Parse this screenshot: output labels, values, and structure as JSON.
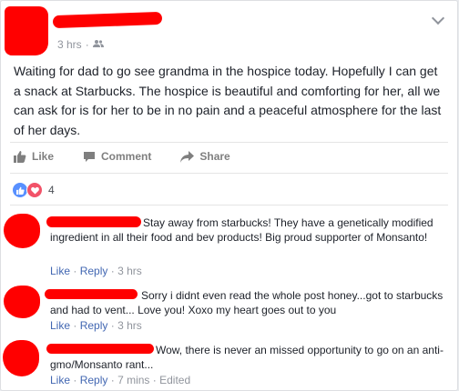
{
  "post": {
    "timestamp": "3 hrs",
    "audience_icon": "friends-icon",
    "text": "Waiting for dad to go see grandma in the hospice today. Hopefully I can get a snack at Starbucks. The hospice is beautiful and comforting for her, all we can ask for is for her to be in no pain and a peaceful atmosphere for the last of her days."
  },
  "actions": {
    "like": "Like",
    "comment": "Comment",
    "share": "Share"
  },
  "reactions": {
    "count": "4"
  },
  "comments": [
    {
      "text": "Stay away from starbucks! They have a genetically modified ingredient in all their food and bev products! Big proud supporter of Monsanto!",
      "like": "Like",
      "reply": "Reply",
      "sep": "·",
      "time": "3 hrs"
    },
    {
      "text": "Sorry i didnt even read the whole post honey...got to starbucks and had to vent... Love you! Xoxo my heart goes out to you",
      "like": "Like",
      "reply": "Reply",
      "sep": "·",
      "time": "3 hrs"
    },
    {
      "text": "Wow, there is never an missed opportunity to go on an anti-gmo/Monsanto rant...",
      "like": "Like",
      "reply": "Reply",
      "sep": "·",
      "time": "7 mins",
      "edited": "Edited"
    }
  ],
  "colors": {
    "link": "#4267b2",
    "meta": "#90949c",
    "redaction": "#ff0000"
  }
}
